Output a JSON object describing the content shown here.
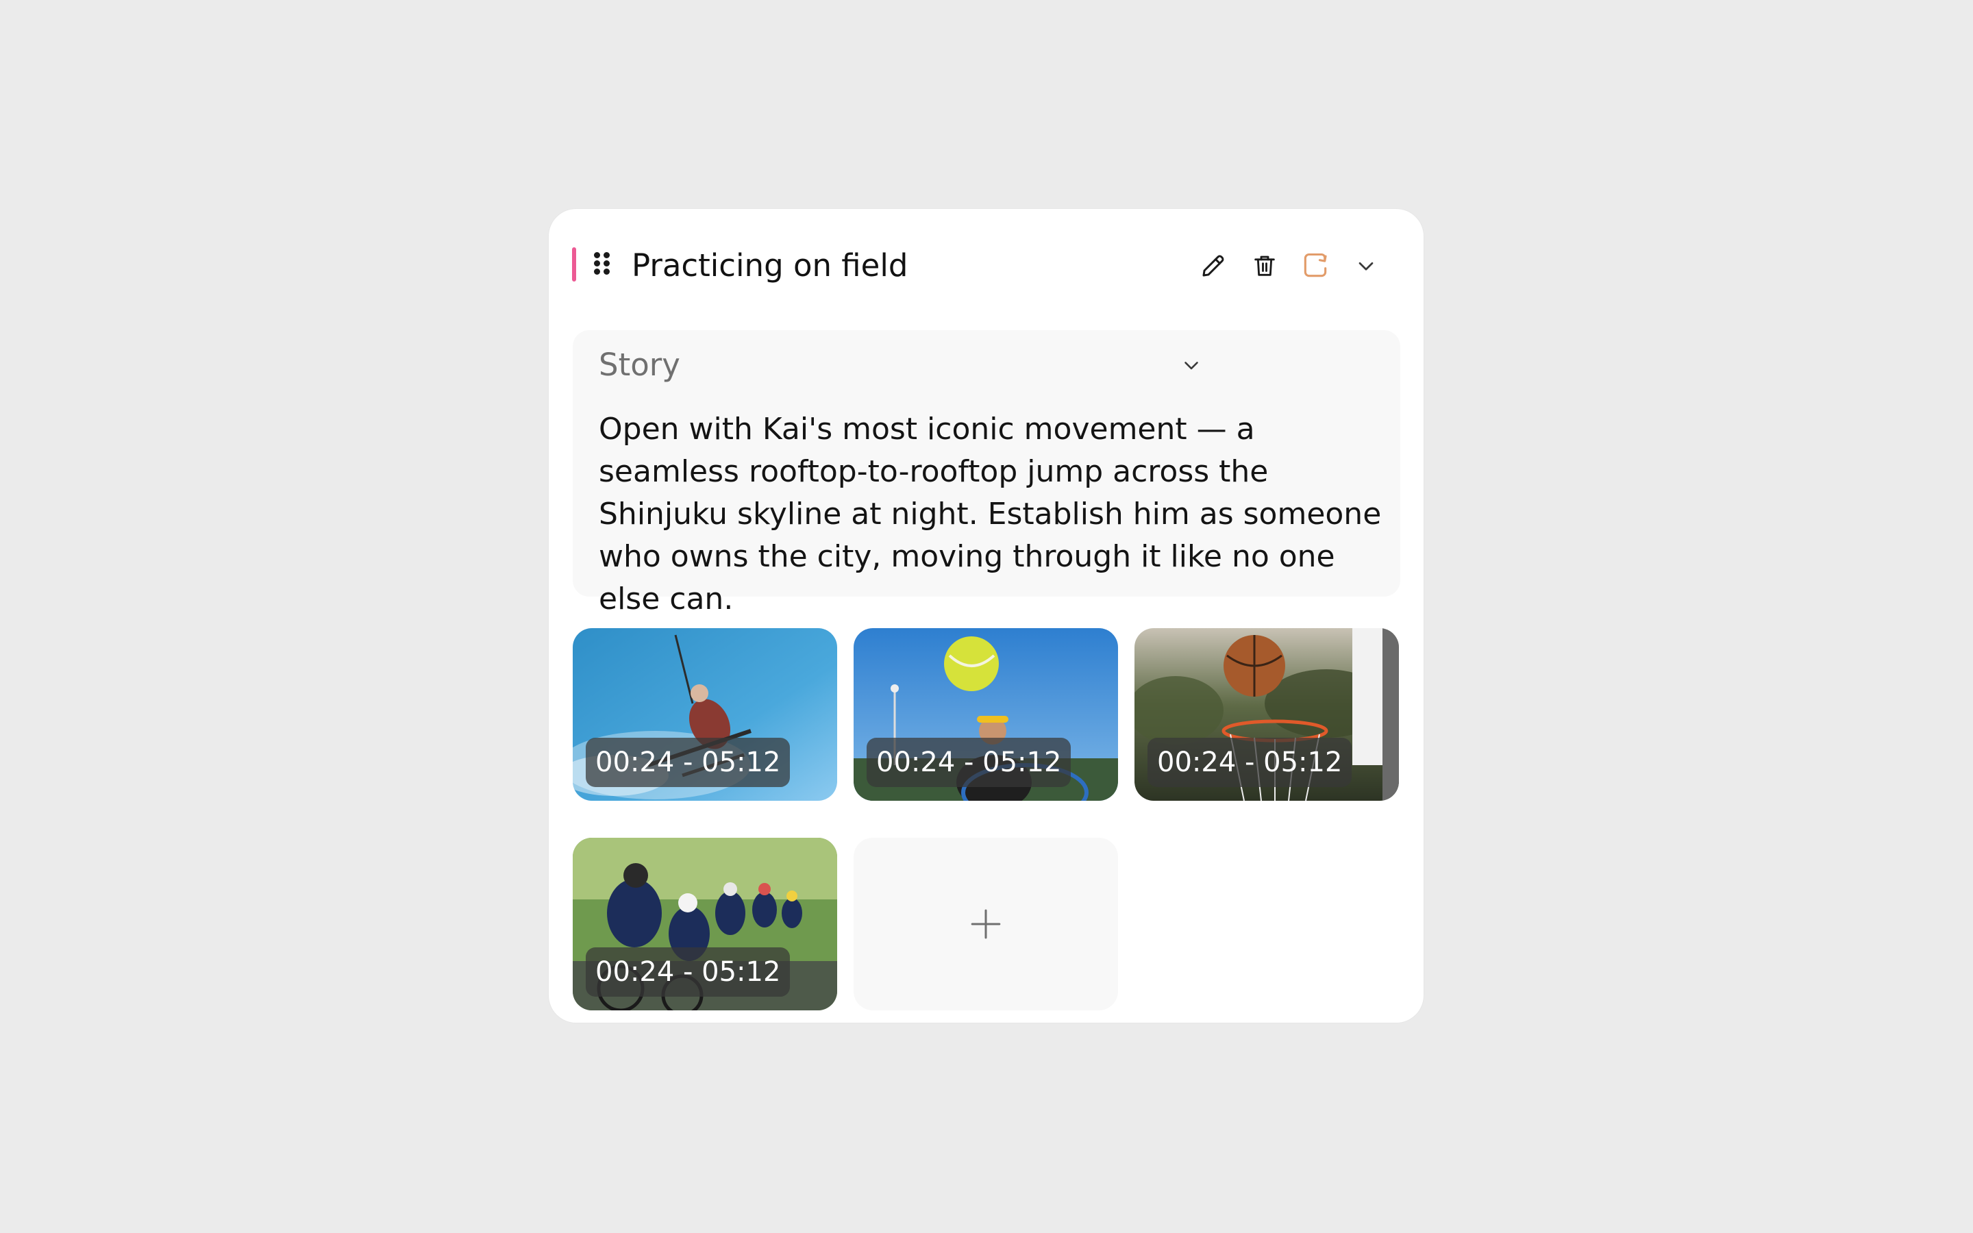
{
  "section": {
    "title": "Practicing on field",
    "accent_color": "#ec5a94",
    "actions": [
      {
        "name": "pencil-icon"
      },
      {
        "name": "trash-icon"
      },
      {
        "name": "refresh-icon",
        "color": "#e29c6a"
      },
      {
        "name": "chevron-down-icon"
      }
    ]
  },
  "story": {
    "label": "Story",
    "text": "Open with Kai's most iconic movement — a seamless rooftop-to-rooftop jump across the Shinjuku skyline at night. Establish him as someone who owns the city, moving through it like no one else can."
  },
  "clips": [
    {
      "subject": "skier",
      "time_range": "00:24 - 05:12"
    },
    {
      "subject": "tennis",
      "time_range": "00:24 - 05:12"
    },
    {
      "subject": "basketball",
      "time_range": "00:24 - 05:12"
    },
    {
      "subject": "cyclists",
      "time_range": "00:24 - 05:12"
    }
  ],
  "add_clip": {
    "icon": "plus-icon"
  }
}
